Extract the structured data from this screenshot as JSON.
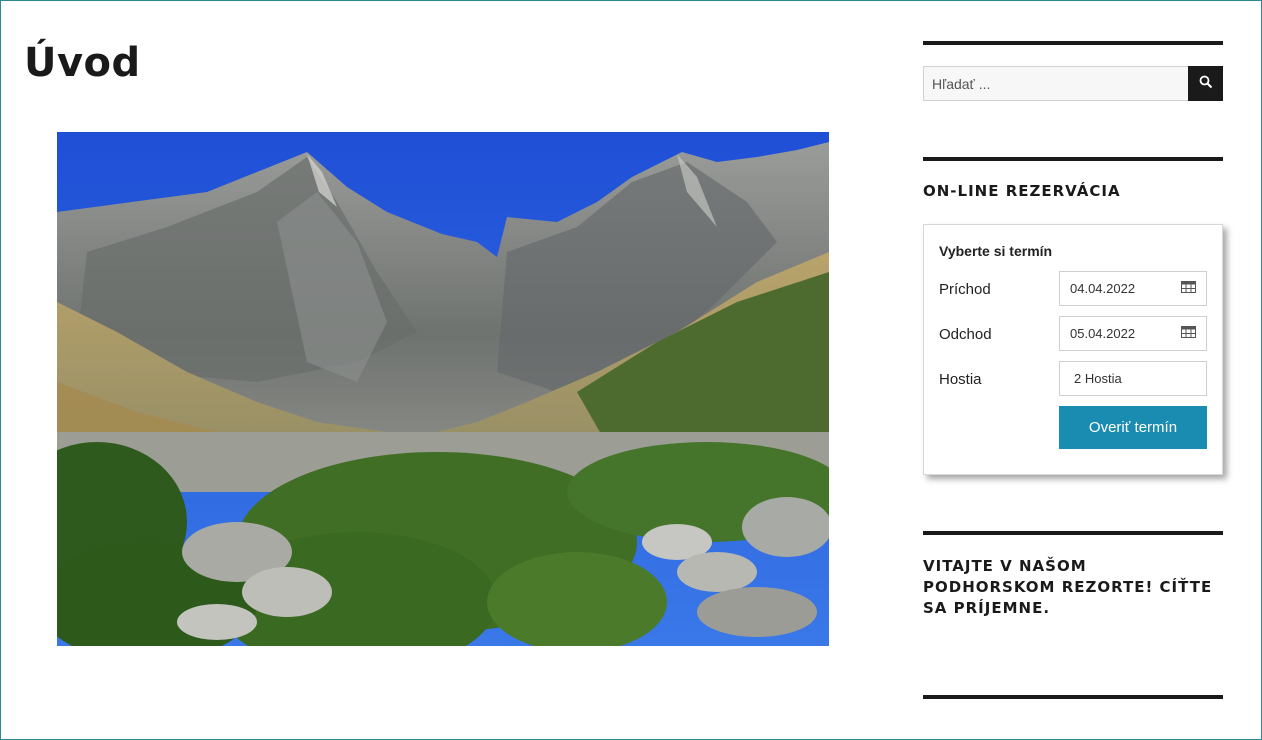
{
  "page": {
    "title": "Úvod"
  },
  "hero": {
    "alt": "mountain landscape photo"
  },
  "search": {
    "placeholder": "Hľadať ...",
    "icon": "search-icon"
  },
  "booking": {
    "heading": "ON-LINE REZERVÁCIA",
    "form_title": "Vyberte si termín",
    "arrival_label": "Príchod",
    "arrival_value": "04.04.2022",
    "departure_label": "Odchod",
    "departure_value": "05.04.2022",
    "guests_label": "Hostia",
    "guests_value": "2 Hostia",
    "calendar_icon": "calendar-icon",
    "submit_label": "Overiť termín",
    "accent_color": "#1a8bb1"
  },
  "welcome": {
    "text": "VITAJTE V NAŠOM PODHORSKOM REZORTE! CÍŤTE SA PRÍJEMNE."
  },
  "colors": {
    "frame": "#2a8a94",
    "text": "#1a1a1a",
    "rule": "#1a1a1a"
  }
}
